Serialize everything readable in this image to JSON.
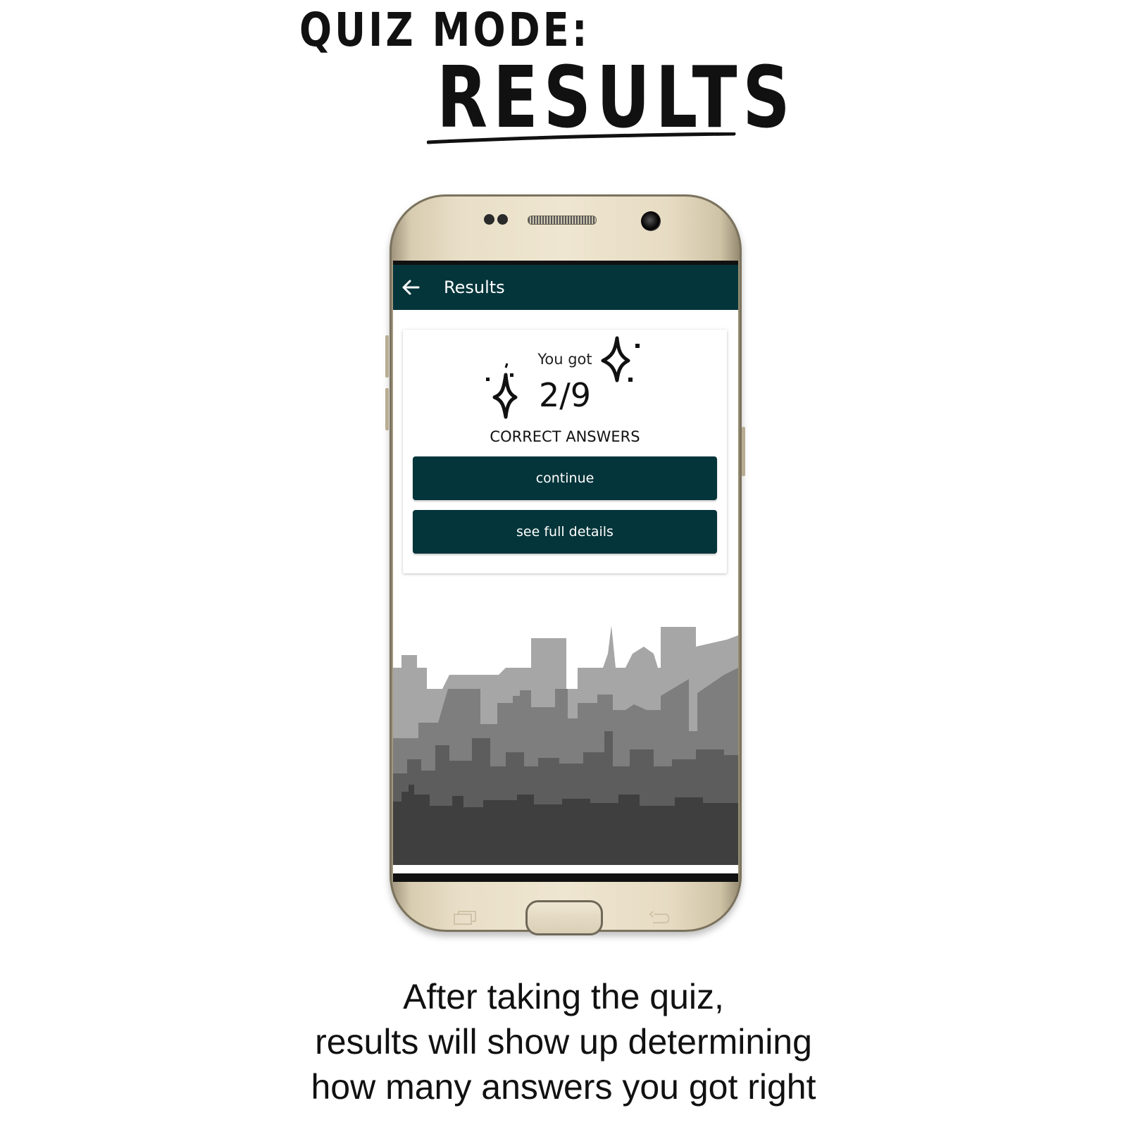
{
  "heading": {
    "line1": "QUIZ MODE:",
    "line2": "RESULTS"
  },
  "app": {
    "title": "Results",
    "back_icon": "arrow-left-icon",
    "bar_color": "#04353a"
  },
  "result_card": {
    "intro": "You got",
    "score": "2/9",
    "label": "CORRECT ANSWERS",
    "decoration_icon": "sparkle-icon"
  },
  "buttons": {
    "continue_label": "continue",
    "details_label": "see full details"
  },
  "caption": {
    "line1": "After taking the quiz,",
    "line2": "results will show up determining",
    "line3": "how many answers you got right"
  }
}
